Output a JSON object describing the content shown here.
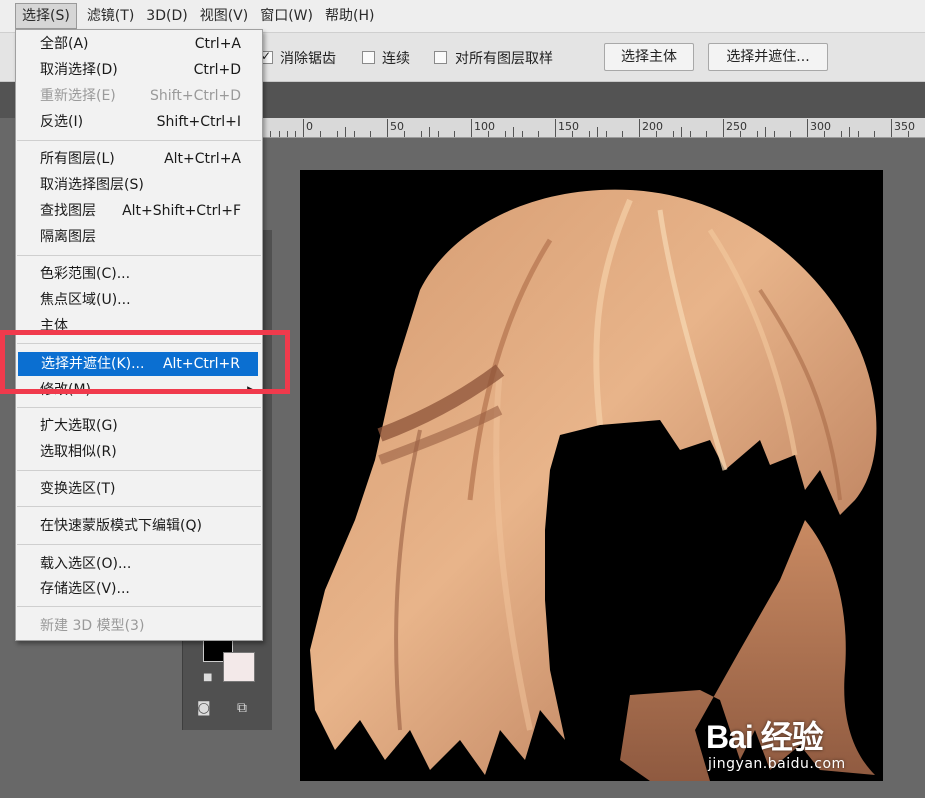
{
  "menubar": {
    "items": [
      {
        "label": "",
        "active": false
      },
      {
        "label": "选择(S)",
        "active": true
      },
      {
        "label": "滤镜(T)",
        "active": false
      },
      {
        "label": "3D(D)",
        "active": false
      },
      {
        "label": "视图(V)",
        "active": false
      },
      {
        "label": "窗口(W)",
        "active": false
      },
      {
        "label": "帮助(H)",
        "active": false
      }
    ]
  },
  "options": {
    "antialias_label": "消除锯齿",
    "contiguous_label": "连续",
    "all_layers_label": "对所有图层取样",
    "select_subject_button": "选择主体",
    "select_mask_button": "选择并遮住..."
  },
  "ruler": {
    "labels": [
      "0",
      "50",
      "100",
      "150",
      "200",
      "250",
      "300",
      "350"
    ]
  },
  "select_menu": {
    "items": [
      {
        "label": "全部(A)",
        "shortcut": "Ctrl+A"
      },
      {
        "label": "取消选择(D)",
        "shortcut": "Ctrl+D"
      },
      {
        "label": "重新选择(E)",
        "shortcut": "Shift+Ctrl+D",
        "disabled": true
      },
      {
        "label": "反选(I)",
        "shortcut": "Shift+Ctrl+I"
      },
      {
        "label": "所有图层(L)",
        "shortcut": "Alt+Ctrl+A"
      },
      {
        "label": "取消选择图层(S)",
        "shortcut": ""
      },
      {
        "label": "查找图层",
        "shortcut": "Alt+Shift+Ctrl+F"
      },
      {
        "label": "隔离图层",
        "shortcut": ""
      },
      {
        "label": "色彩范围(C)...",
        "shortcut": ""
      },
      {
        "label": "焦点区域(U)...",
        "shortcut": ""
      },
      {
        "label": "主体",
        "shortcut": ""
      },
      {
        "label": "选择并遮住(K)...",
        "shortcut": "Alt+Ctrl+R",
        "highlighted": true
      },
      {
        "label": "修改(M)",
        "shortcut": "",
        "submenu": true
      },
      {
        "label": "扩大选取(G)",
        "shortcut": ""
      },
      {
        "label": "选取相似(R)",
        "shortcut": ""
      },
      {
        "label": "变换选区(T)",
        "shortcut": ""
      },
      {
        "label": "在快速蒙版模式下编辑(Q)",
        "shortcut": ""
      },
      {
        "label": "载入选区(O)...",
        "shortcut": ""
      },
      {
        "label": "存储选区(V)...",
        "shortcut": ""
      },
      {
        "label": "新建 3D 模型(3)",
        "shortcut": "",
        "disabled": true
      }
    ]
  },
  "colors": {
    "highlight": "#0b6fd1",
    "annotation_box": "#f03a4c",
    "hair": "#c98a62"
  },
  "watermark": {
    "logo": "Bai 经验",
    "url": "jingyan.baidu.com"
  }
}
